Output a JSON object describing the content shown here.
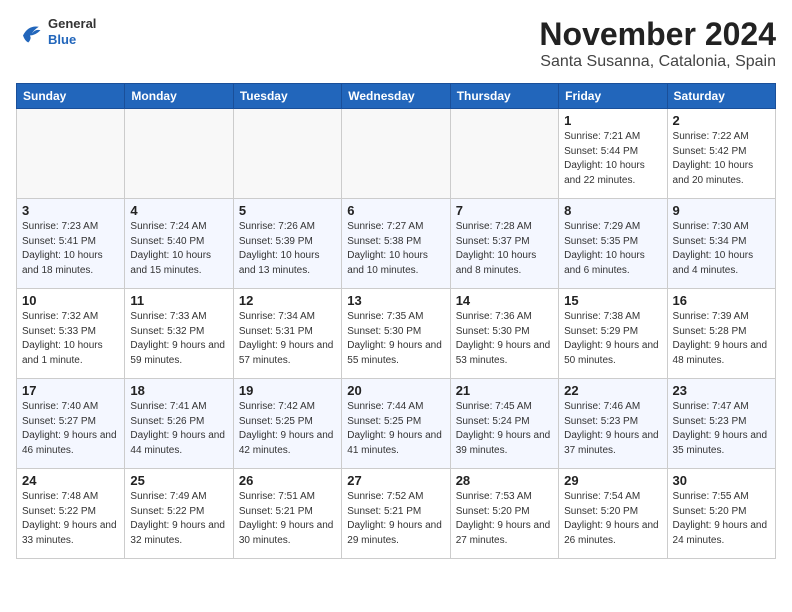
{
  "header": {
    "logo_general": "General",
    "logo_blue": "Blue",
    "month_title": "November 2024",
    "location": "Santa Susanna, Catalonia, Spain"
  },
  "weekdays": [
    "Sunday",
    "Monday",
    "Tuesday",
    "Wednesday",
    "Thursday",
    "Friday",
    "Saturday"
  ],
  "weeks": [
    [
      {
        "day": "",
        "info": ""
      },
      {
        "day": "",
        "info": ""
      },
      {
        "day": "",
        "info": ""
      },
      {
        "day": "",
        "info": ""
      },
      {
        "day": "",
        "info": ""
      },
      {
        "day": "1",
        "info": "Sunrise: 7:21 AM\nSunset: 5:44 PM\nDaylight: 10 hours and 22 minutes."
      },
      {
        "day": "2",
        "info": "Sunrise: 7:22 AM\nSunset: 5:42 PM\nDaylight: 10 hours and 20 minutes."
      }
    ],
    [
      {
        "day": "3",
        "info": "Sunrise: 7:23 AM\nSunset: 5:41 PM\nDaylight: 10 hours and 18 minutes."
      },
      {
        "day": "4",
        "info": "Sunrise: 7:24 AM\nSunset: 5:40 PM\nDaylight: 10 hours and 15 minutes."
      },
      {
        "day": "5",
        "info": "Sunrise: 7:26 AM\nSunset: 5:39 PM\nDaylight: 10 hours and 13 minutes."
      },
      {
        "day": "6",
        "info": "Sunrise: 7:27 AM\nSunset: 5:38 PM\nDaylight: 10 hours and 10 minutes."
      },
      {
        "day": "7",
        "info": "Sunrise: 7:28 AM\nSunset: 5:37 PM\nDaylight: 10 hours and 8 minutes."
      },
      {
        "day": "8",
        "info": "Sunrise: 7:29 AM\nSunset: 5:35 PM\nDaylight: 10 hours and 6 minutes."
      },
      {
        "day": "9",
        "info": "Sunrise: 7:30 AM\nSunset: 5:34 PM\nDaylight: 10 hours and 4 minutes."
      }
    ],
    [
      {
        "day": "10",
        "info": "Sunrise: 7:32 AM\nSunset: 5:33 PM\nDaylight: 10 hours and 1 minute."
      },
      {
        "day": "11",
        "info": "Sunrise: 7:33 AM\nSunset: 5:32 PM\nDaylight: 9 hours and 59 minutes."
      },
      {
        "day": "12",
        "info": "Sunrise: 7:34 AM\nSunset: 5:31 PM\nDaylight: 9 hours and 57 minutes."
      },
      {
        "day": "13",
        "info": "Sunrise: 7:35 AM\nSunset: 5:30 PM\nDaylight: 9 hours and 55 minutes."
      },
      {
        "day": "14",
        "info": "Sunrise: 7:36 AM\nSunset: 5:30 PM\nDaylight: 9 hours and 53 minutes."
      },
      {
        "day": "15",
        "info": "Sunrise: 7:38 AM\nSunset: 5:29 PM\nDaylight: 9 hours and 50 minutes."
      },
      {
        "day": "16",
        "info": "Sunrise: 7:39 AM\nSunset: 5:28 PM\nDaylight: 9 hours and 48 minutes."
      }
    ],
    [
      {
        "day": "17",
        "info": "Sunrise: 7:40 AM\nSunset: 5:27 PM\nDaylight: 9 hours and 46 minutes."
      },
      {
        "day": "18",
        "info": "Sunrise: 7:41 AM\nSunset: 5:26 PM\nDaylight: 9 hours and 44 minutes."
      },
      {
        "day": "19",
        "info": "Sunrise: 7:42 AM\nSunset: 5:25 PM\nDaylight: 9 hours and 42 minutes."
      },
      {
        "day": "20",
        "info": "Sunrise: 7:44 AM\nSunset: 5:25 PM\nDaylight: 9 hours and 41 minutes."
      },
      {
        "day": "21",
        "info": "Sunrise: 7:45 AM\nSunset: 5:24 PM\nDaylight: 9 hours and 39 minutes."
      },
      {
        "day": "22",
        "info": "Sunrise: 7:46 AM\nSunset: 5:23 PM\nDaylight: 9 hours and 37 minutes."
      },
      {
        "day": "23",
        "info": "Sunrise: 7:47 AM\nSunset: 5:23 PM\nDaylight: 9 hours and 35 minutes."
      }
    ],
    [
      {
        "day": "24",
        "info": "Sunrise: 7:48 AM\nSunset: 5:22 PM\nDaylight: 9 hours and 33 minutes."
      },
      {
        "day": "25",
        "info": "Sunrise: 7:49 AM\nSunset: 5:22 PM\nDaylight: 9 hours and 32 minutes."
      },
      {
        "day": "26",
        "info": "Sunrise: 7:51 AM\nSunset: 5:21 PM\nDaylight: 9 hours and 30 minutes."
      },
      {
        "day": "27",
        "info": "Sunrise: 7:52 AM\nSunset: 5:21 PM\nDaylight: 9 hours and 29 minutes."
      },
      {
        "day": "28",
        "info": "Sunrise: 7:53 AM\nSunset: 5:20 PM\nDaylight: 9 hours and 27 minutes."
      },
      {
        "day": "29",
        "info": "Sunrise: 7:54 AM\nSunset: 5:20 PM\nDaylight: 9 hours and 26 minutes."
      },
      {
        "day": "30",
        "info": "Sunrise: 7:55 AM\nSunset: 5:20 PM\nDaylight: 9 hours and 24 minutes."
      }
    ]
  ]
}
